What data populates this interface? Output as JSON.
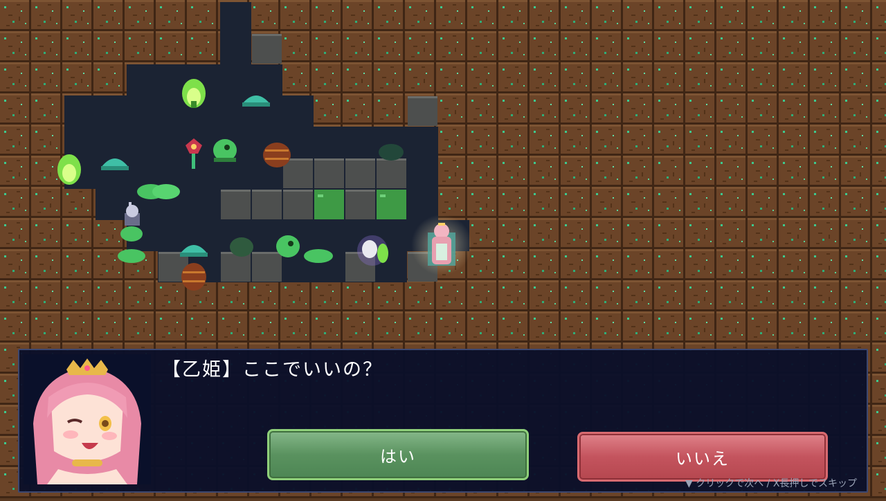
{
  "dialog": {
    "speaker_line": "【乙姫】ここでいいの？",
    "yes_label": "はい",
    "no_label": "いいえ",
    "hint": "▼ クリックで次へ / X長押しでスキップ"
  },
  "colors": {
    "dirt": "#6b4428",
    "cave_floor": "#1b2333",
    "stone": "#4d4f4e",
    "moss_block": "#3e9a45",
    "dialog_bg": "#0a102a",
    "yes_button": "#5a925f",
    "no_button": "#c4545e"
  }
}
